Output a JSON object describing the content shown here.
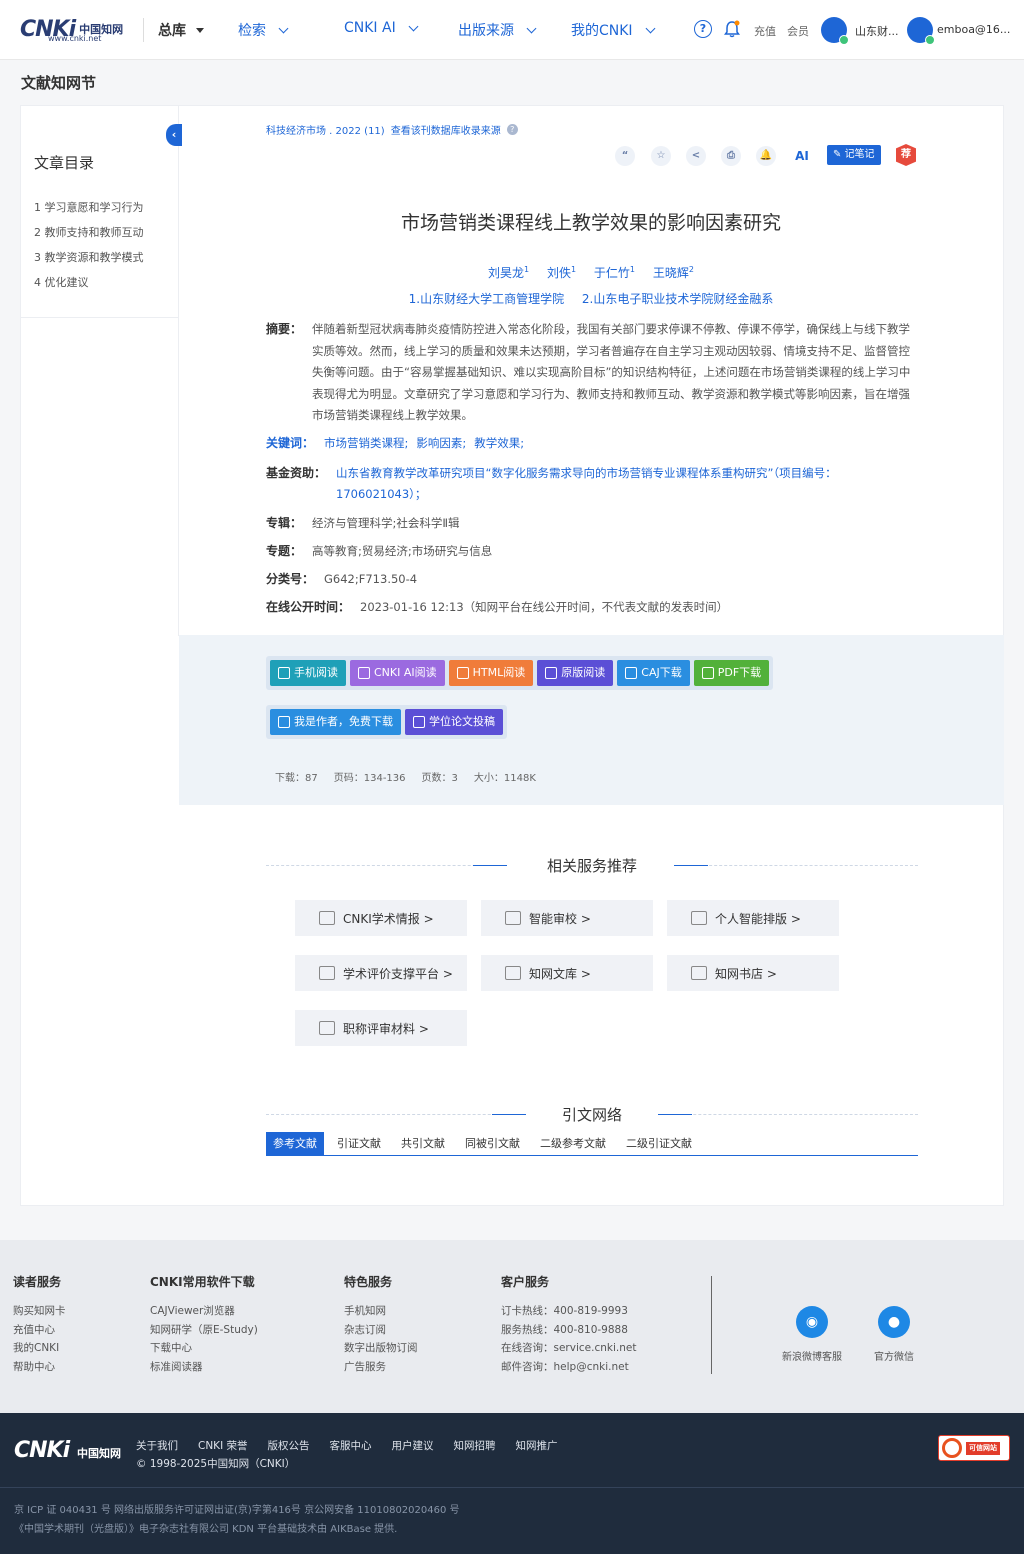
{
  "header": {
    "logo_cn": "CNKi",
    "logo_sub": "www.cnki.net",
    "logo_zh": "中国知网",
    "nav": [
      {
        "label": "总库"
      },
      {
        "label": "检索"
      },
      {
        "label": "CNKI AI"
      },
      {
        "label": "出版来源"
      },
      {
        "label": "我的CNKI"
      }
    ],
    "help_icon": "?",
    "recharge": "充值",
    "member": "会员",
    "institution": "山东财...",
    "user": "emboa@16..."
  },
  "page_title": "文献知网节",
  "sidebar": {
    "collapse": "‹",
    "title": "文章目录",
    "items": [
      "1 学习意愿和学习行为",
      "2 教师支持和教师互动",
      "3 教学资源和教学模式",
      "4 优化建议"
    ]
  },
  "article": {
    "source": "科技经济市场 .  2022 (11)",
    "source_link": "查看该刊数据库收录来源",
    "tools": {
      "cite": "“",
      "favorite": "☆",
      "share": "<",
      "print": "⎙",
      "alert": "🔔",
      "ai": "AI",
      "note": "记笔记",
      "recommend": "荐"
    },
    "title": "市场营销类课程线上教学效果的影响因素研究",
    "authors": [
      {
        "name": "刘昊龙",
        "sup": "1"
      },
      {
        "name": "刘佚",
        "sup": "1"
      },
      {
        "name": "于仁竹",
        "sup": "1"
      },
      {
        "name": "王晓辉",
        "sup": "2"
      }
    ],
    "affiliations": [
      "1.山东财经大学工商管理学院",
      "2.山东电子职业技术学院财经金融系"
    ],
    "abstract_label": "摘要：",
    "abstract": "伴随着新型冠状病毒肺炎疫情防控进入常态化阶段，我国有关部门要求停课不停教、停课不停学，确保线上与线下教学实质等效。然而，线上学习的质量和效果未达预期，学习者普遍存在自主学习主观动因较弱、情境支持不足、监督管控失衡等问题。由于“容易掌握基础知识、难以实现高阶目标”的知识结构特征，上述问题在市场营销类课程的线上学习中表现得尤为明显。文章研究了学习意愿和学习行为、教师支持和教师互动、教学资源和教学模式等影响因素，旨在增强市场营销类课程线上教学效果。",
    "keywords_label": "关键词：",
    "keywords": [
      "市场营销类课程;",
      "影响因素;",
      "教学效果;"
    ],
    "fund_label": "基金资助：",
    "fund": "山东省教育教学改革研究项目“数字化服务需求导向的市场营销专业课程体系重构研究”（项目编号：1706021043）；",
    "series_label": "专辑：",
    "series": "经济与管理科学;社会科学Ⅱ辑",
    "topic_label": "专题：",
    "topic": "高等教育;贸易经济;市场研究与信息",
    "class_label": "分类号：",
    "class": "G642;F713.50-4",
    "online_label": "在线公开时间：",
    "online": "2023-01-16 12:13（知网平台在线公开时间，不代表文献的发表时间）"
  },
  "downloads": {
    "buttons_row1": [
      {
        "label": "手机阅读",
        "color": "#1fa0b8"
      },
      {
        "label": "CNKI AI阅读",
        "color": "#9b6ae0"
      },
      {
        "label": "HTML阅读",
        "color": "#f07c3a"
      },
      {
        "label": "原版阅读",
        "color": "#5b4fd6"
      },
      {
        "label": "CAJ下载",
        "color": "#2a8ee0"
      },
      {
        "label": "PDF下载",
        "color": "#52b13a"
      }
    ],
    "buttons_row2": [
      {
        "label": "我是作者，免费下载",
        "color": "#2a8ee0"
      },
      {
        "label": "学位论文投稿",
        "color": "#5b4fd6"
      }
    ],
    "stats": {
      "downloads": "下载：87",
      "pages": "页码：134-136",
      "page_count": "页数：3",
      "size": "大小：1148K"
    }
  },
  "related": {
    "title": "相关服务推荐",
    "items": [
      "CNKI学术情报 >",
      "智能审校 >",
      "个人智能排版 >",
      "学术评价支撑平台 >",
      "知网文库 >",
      "知网书店 >",
      "职称评审材料 >"
    ]
  },
  "citation": {
    "title": "引文网络",
    "tabs": [
      "参考文献",
      "引证文献",
      "共引文献",
      "同被引文献",
      "二级参考文献",
      "二级引证文献"
    ]
  },
  "footer": {
    "cols": [
      {
        "title": "读者服务",
        "items": [
          "购买知网卡",
          "充值中心",
          "我的CNKI",
          "帮助中心"
        ]
      },
      {
        "title": "CNKI常用软件下载",
        "items": [
          "CAJViewer浏览器",
          "知网研学（原E-Study)",
          "下载中心",
          "标准阅读器"
        ]
      },
      {
        "title": "特色服务",
        "items": [
          "手机知网",
          "杂志订阅",
          "数字出版物订阅",
          "广告服务"
        ]
      },
      {
        "title": "客户服务",
        "items": [
          "订卡热线：400-819-9993",
          "服务热线：400-810-9888",
          "在线咨询：service.cnki.net",
          "邮件咨询：help@cnki.net"
        ]
      }
    ],
    "weibo": "新浪微博客服",
    "wechat": "官方微信"
  },
  "bottom": {
    "links": [
      "关于我们",
      "CNKI 荣誉",
      "版权公告",
      "客服中心",
      "用户建议",
      "知网招聘",
      "知网推广"
    ],
    "copyright": "© 1998-2025中国知网（CNKI）",
    "icp1": "京 ICP 证 040431 号  网络出版服务许可证网出证(京)字第416号  京公网安备 11010802020460 号",
    "icp2": "《中国学术期刊（光盘版）》电子杂志社有限公司  KDN 平台基础技术由 AIKBase 提供.",
    "trust": "可信网站"
  }
}
